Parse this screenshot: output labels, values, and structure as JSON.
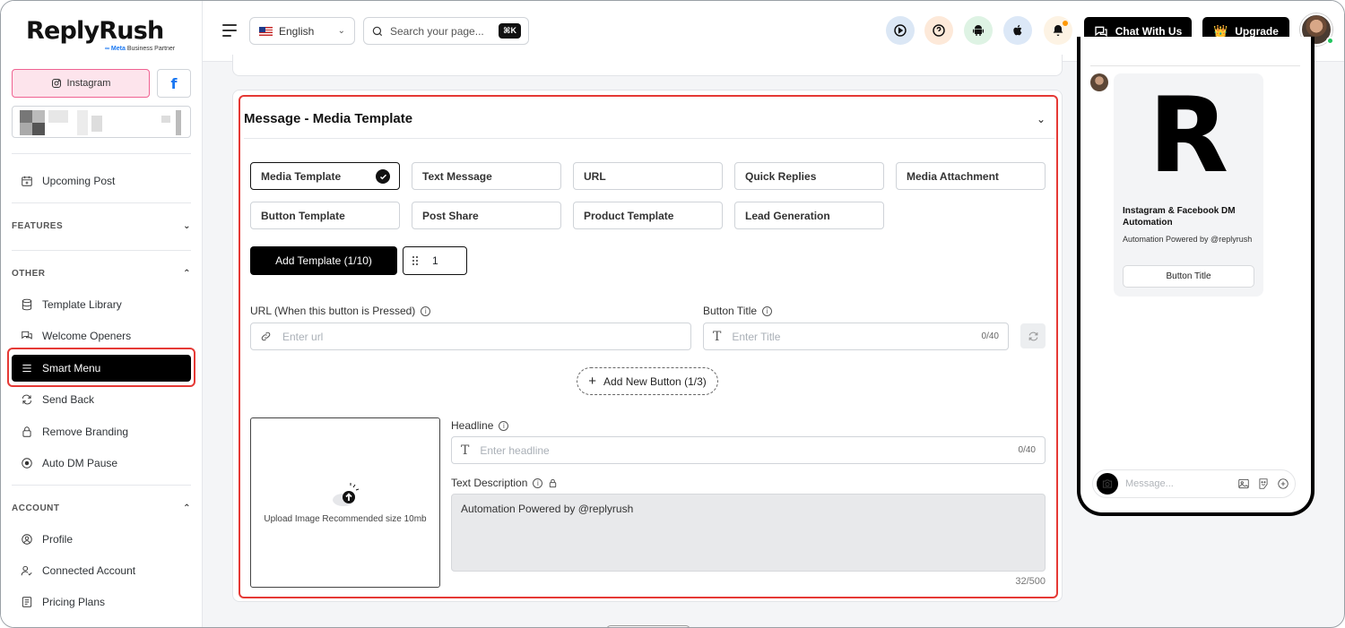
{
  "brand": {
    "name": "ReplyRush",
    "partner_prefix": "∞ Meta",
    "partner_suffix": " Business Partner"
  },
  "sidebar": {
    "accounts": {
      "instagram_label": "Instagram",
      "facebook_label": "f"
    },
    "items": [
      {
        "label": "Upcoming Post"
      },
      {
        "label": "Template Library"
      },
      {
        "label": "Welcome Openers"
      },
      {
        "label": "Smart Menu"
      },
      {
        "label": "Send Back"
      },
      {
        "label": "Remove Branding"
      },
      {
        "label": "Auto DM Pause"
      },
      {
        "label": "Profile"
      },
      {
        "label": "Connected Account"
      },
      {
        "label": "Pricing Plans"
      }
    ],
    "sections": {
      "features": "FEATURES",
      "other": "OTHER",
      "account": "ACCOUNT"
    }
  },
  "topbar": {
    "language": "English",
    "search_placeholder": "Search your page...",
    "search_shortcut": "⌘K",
    "chat_label": "Chat With Us",
    "upgrade_label": "Upgrade",
    "upgrade_icon": "👑"
  },
  "card": {
    "title": "Message - Media Template",
    "tabs": [
      "Media Template",
      "Text Message",
      "URL",
      "Quick Replies",
      "Media Attachment",
      "Button Template",
      "Post Share",
      "Product Template",
      "Lead Generation"
    ],
    "selected_tab": "Media Template",
    "add_template_label": "Add Template (1/10)",
    "template_number": "1",
    "url_label": "URL (When this button is Pressed)",
    "url_placeholder": "Enter url",
    "button_title_label": "Button Title",
    "button_title_placeholder": "Enter Title",
    "button_title_count": "0/40",
    "add_button_label": "Add New Button (1/3)",
    "upload_label": "Upload Image Recommended size 10mb",
    "headline_label": "Headline",
    "headline_placeholder": "Enter headline",
    "headline_count": "0/40",
    "description_label": "Text Description",
    "description_value": "Automation Powered by @replyrush",
    "description_count": "32/500"
  },
  "preview": {
    "image_letter": "R",
    "title": "Instagram & Facebook DM Automation",
    "description": "Automation Powered by @replyrush",
    "button_title": "Button Title",
    "message_placeholder": "Message..."
  },
  "colors": {
    "accent": "#000000",
    "highlight": "#e53935",
    "instagram_bg": "#fde4ec",
    "facebook": "#1877f2"
  }
}
